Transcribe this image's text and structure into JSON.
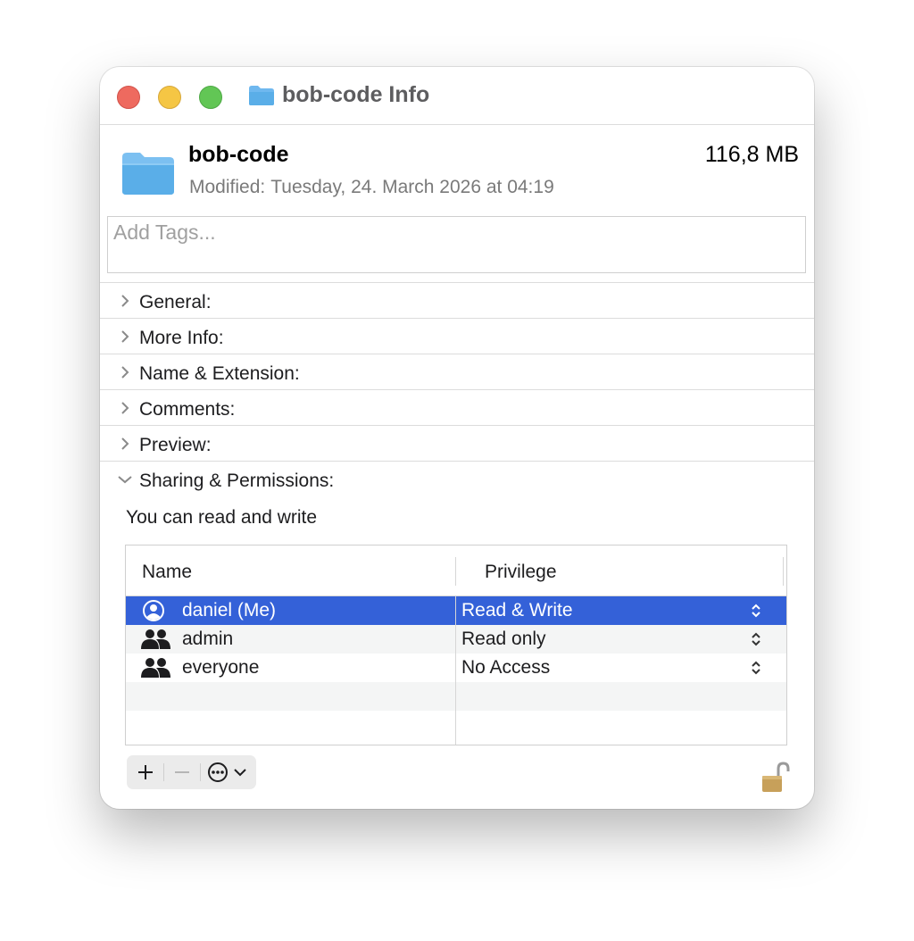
{
  "window": {
    "title": "bob-code Info"
  },
  "header": {
    "name": "bob-code",
    "size": "116,8 MB",
    "modified_label": "Modified:",
    "modified_value": "Tuesday, 24. March 2026 at 04:19"
  },
  "tags": {
    "placeholder": "Add Tags..."
  },
  "sections": [
    {
      "label": "General:",
      "expanded": false
    },
    {
      "label": "More Info:",
      "expanded": false
    },
    {
      "label": "Name & Extension:",
      "expanded": false
    },
    {
      "label": "Comments:",
      "expanded": false
    },
    {
      "label": "Preview:",
      "expanded": false
    },
    {
      "label": "Sharing & Permissions:",
      "expanded": true
    }
  ],
  "permissions": {
    "note": "You can read and write",
    "columns": {
      "name": "Name",
      "privilege": "Privilege"
    },
    "rows": [
      {
        "name": "daniel (Me)",
        "privilege": "Read & Write",
        "icon": "person-circle-icon",
        "selected": true
      },
      {
        "name": "admin",
        "privilege": "Read only",
        "icon": "group-icon",
        "selected": false
      },
      {
        "name": "everyone",
        "privilege": "No Access",
        "icon": "group-icon",
        "selected": false
      }
    ]
  },
  "toolbar": {
    "add_icon": "plus-icon",
    "remove_icon": "minus-icon",
    "actions_icon": "ellipsis-circle-icon"
  },
  "colors": {
    "selection": "#3461d8",
    "folder": "#5aaee8",
    "close": "#ee6a5f",
    "minimize": "#f5c644",
    "zoom": "#62c655"
  }
}
